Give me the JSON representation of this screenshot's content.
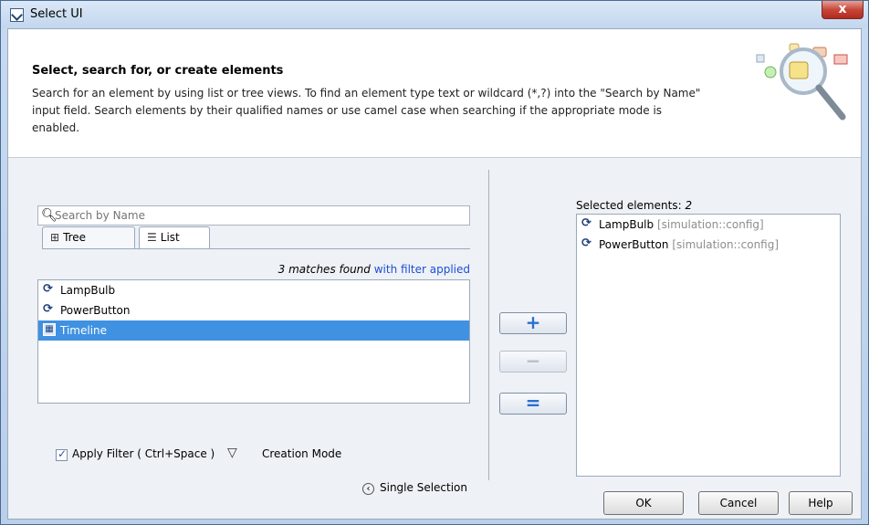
{
  "window": {
    "title": "Select UI",
    "close_label": "x"
  },
  "header": {
    "title": "Select, search for, or create elements",
    "description": "Search for an element by using list or tree views. To find an element type text or wildcard (*,?) into the \"Search by Name\" input field. Search elements by their qualified names or use camel case when searching if the appropriate mode is enabled."
  },
  "search": {
    "placeholder": "Search by Name",
    "value": ""
  },
  "tabs": [
    {
      "label": "Tree",
      "icon": "tree-icon"
    },
    {
      "label": "List",
      "icon": "list-icon"
    }
  ],
  "matches": {
    "count_text": "3 matches found",
    "filter_text": "with filter applied"
  },
  "list": {
    "items": [
      {
        "label": "LampBulb",
        "icon": "signal-icon"
      },
      {
        "label": "PowerButton",
        "icon": "signal-icon"
      },
      {
        "label": "Timeline",
        "icon": "timeline-icon",
        "selected": true
      }
    ]
  },
  "options": {
    "apply_filter": {
      "label": "Apply Filter ( Ctrl+Space )",
      "checked": true
    },
    "creation_mode": "Creation Mode",
    "single_selection": "Single Selection"
  },
  "buttons": {
    "add": "+",
    "remove": "−",
    "replace": "="
  },
  "selected": {
    "label": "Selected elements:",
    "count": "2",
    "items": [
      {
        "label": "LampBulb",
        "path": "[simulation::config]",
        "icon": "signal-icon"
      },
      {
        "label": "PowerButton",
        "path": "[simulation::config]",
        "icon": "signal-icon"
      }
    ]
  },
  "footer": {
    "ok": "OK",
    "cancel": "Cancel",
    "help": "Help"
  },
  "colors": {
    "selection": "#3f91e2",
    "filter_link": "#1a4fd6"
  }
}
